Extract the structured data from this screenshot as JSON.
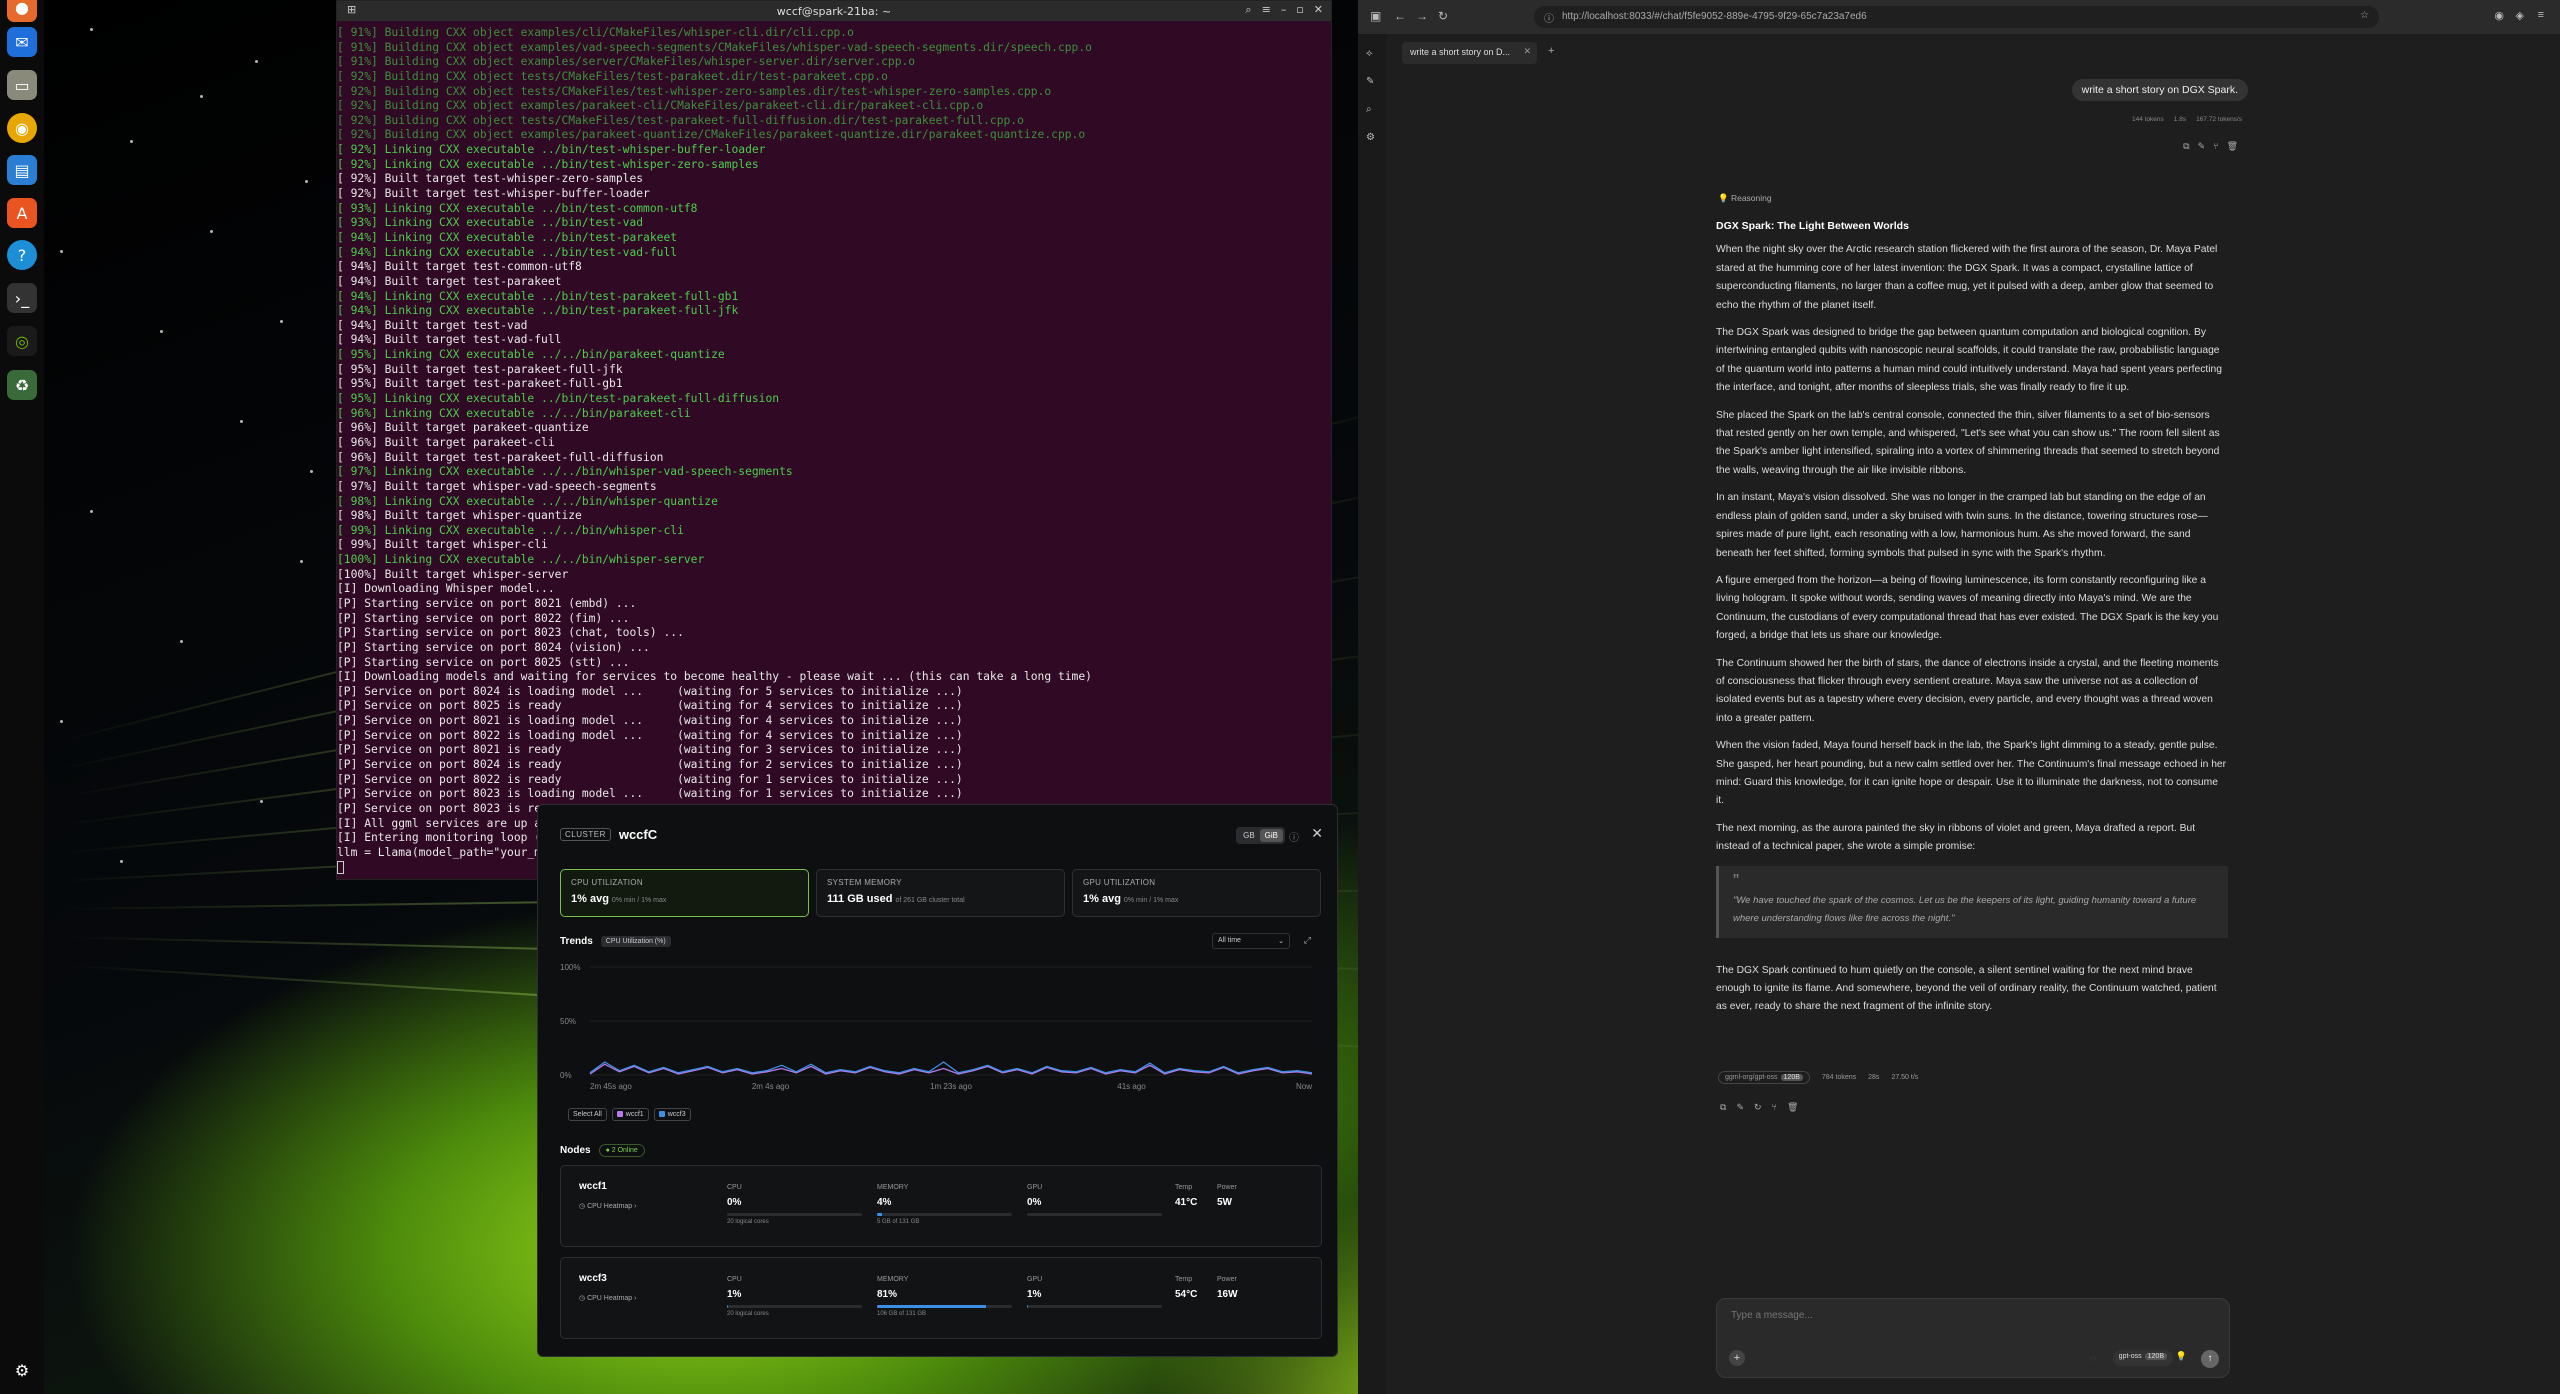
{
  "terminal": {
    "title": "wccf@spark-21ba: ~",
    "lines": [
      {
        "t": "[ 91%] Building CXX object examples/cli/CMakeFiles/whisper-cli.dir/cli.cpp.o",
        "c": "dim"
      },
      {
        "t": "[ 91%] Building CXX object examples/vad-speech-segments/CMakeFiles/whisper-vad-speech-segments.dir/speech.cpp.o",
        "c": "dim"
      },
      {
        "t": "[ 91%] Building CXX object examples/server/CMakeFiles/whisper-server.dir/server.cpp.o",
        "c": "dim"
      },
      {
        "t": "[ 92%] Building CXX object tests/CMakeFiles/test-parakeet.dir/test-parakeet.cpp.o",
        "c": "dim"
      },
      {
        "t": "[ 92%] Building CXX object tests/CMakeFiles/test-whisper-zero-samples.dir/test-whisper-zero-samples.cpp.o",
        "c": "dim"
      },
      {
        "t": "[ 92%] Building CXX object examples/parakeet-cli/CMakeFiles/parakeet-cli.dir/parakeet-cli.cpp.o",
        "c": "dim"
      },
      {
        "t": "[ 92%] Building CXX object tests/CMakeFiles/test-parakeet-full-diffusion.dir/test-parakeet-full.cpp.o",
        "c": "dim"
      },
      {
        "t": "[ 92%] Building CXX object examples/parakeet-quantize/CMakeFiles/parakeet-quantize.dir/parakeet-quantize.cpp.o",
        "c": "dim"
      },
      {
        "t": "[ 92%] Linking CXX executable ../bin/test-whisper-buffer-loader",
        "c": "green"
      },
      {
        "t": "[ 92%] Linking CXX executable ../bin/test-whisper-zero-samples",
        "c": "green"
      },
      {
        "t": "[ 92%] Built target test-whisper-zero-samples",
        "c": ""
      },
      {
        "t": "[ 92%] Built target test-whisper-buffer-loader",
        "c": ""
      },
      {
        "t": "[ 93%] Linking CXX executable ../bin/test-common-utf8",
        "c": "green"
      },
      {
        "t": "[ 93%] Linking CXX executable ../bin/test-vad",
        "c": "green"
      },
      {
        "t": "[ 94%] Linking CXX executable ../bin/test-parakeet",
        "c": "green"
      },
      {
        "t": "[ 94%] Linking CXX executable ../bin/test-vad-full",
        "c": "green"
      },
      {
        "t": "[ 94%] Built target test-common-utf8",
        "c": ""
      },
      {
        "t": "[ 94%] Built target test-parakeet",
        "c": ""
      },
      {
        "t": "[ 94%] Linking CXX executable ../bin/test-parakeet-full-gb1",
        "c": "green"
      },
      {
        "t": "[ 94%] Linking CXX executable ../bin/test-parakeet-full-jfk",
        "c": "green"
      },
      {
        "t": "[ 94%] Built target test-vad",
        "c": ""
      },
      {
        "t": "[ 94%] Built target test-vad-full",
        "c": ""
      },
      {
        "t": "[ 95%] Linking CXX executable ../../bin/parakeet-quantize",
        "c": "green"
      },
      {
        "t": "[ 95%] Built target test-parakeet-full-jfk",
        "c": ""
      },
      {
        "t": "[ 95%] Built target test-parakeet-full-gb1",
        "c": ""
      },
      {
        "t": "[ 95%] Linking CXX executable ../bin/test-parakeet-full-diffusion",
        "c": "green"
      },
      {
        "t": "[ 96%] Linking CXX executable ../../bin/parakeet-cli",
        "c": "green"
      },
      {
        "t": "[ 96%] Built target parakeet-quantize",
        "c": ""
      },
      {
        "t": "[ 96%] Built target parakeet-cli",
        "c": ""
      },
      {
        "t": "[ 96%] Built target test-parakeet-full-diffusion",
        "c": ""
      },
      {
        "t": "[ 97%] Linking CXX executable ../../bin/whisper-vad-speech-segments",
        "c": "green"
      },
      {
        "t": "[ 97%] Built target whisper-vad-speech-segments",
        "c": ""
      },
      {
        "t": "[ 98%] Linking CXX executable ../../bin/whisper-quantize",
        "c": "green"
      },
      {
        "t": "[ 98%] Built target whisper-quantize",
        "c": ""
      },
      {
        "t": "[ 99%] Linking CXX executable ../../bin/whisper-cli",
        "c": "green"
      },
      {
        "t": "[ 99%] Built target whisper-cli",
        "c": ""
      },
      {
        "t": "[100%] Linking CXX executable ../../bin/whisper-server",
        "c": "green"
      },
      {
        "t": "[100%] Built target whisper-server",
        "c": ""
      },
      {
        "t": "[I] Downloading Whisper model...",
        "c": ""
      },
      {
        "t": "[P] Starting service on port 8021 (embd) ...",
        "c": ""
      },
      {
        "t": "[P] Starting service on port 8022 (fim) ...",
        "c": ""
      },
      {
        "t": "[P] Starting service on port 8023 (chat, tools) ...",
        "c": ""
      },
      {
        "t": "[P] Starting service on port 8024 (vision) ...",
        "c": ""
      },
      {
        "t": "[P] Starting service on port 8025 (stt) ...",
        "c": ""
      },
      {
        "t": "[I] Downloading models and waiting for services to become healthy - please wait ... (this can take a long time)",
        "c": ""
      },
      {
        "t": "[P] Service on port 8024 is loading model ...     (waiting for 5 services to initialize ...)",
        "c": ""
      },
      {
        "t": "[P] Service on port 8025 is ready                 (waiting for 4 services to initialize ...)",
        "c": ""
      },
      {
        "t": "[P] Service on port 8021 is loading model ...     (waiting for 4 services to initialize ...)",
        "c": ""
      },
      {
        "t": "[P] Service on port 8022 is loading model ...     (waiting for 4 services to initialize ...)",
        "c": ""
      },
      {
        "t": "[P] Service on port 8021 is ready                 (waiting for 3 services to initialize ...)",
        "c": ""
      },
      {
        "t": "[P] Service on port 8024 is ready                 (waiting for 2 services to initialize ...)",
        "c": ""
      },
      {
        "t": "[P] Service on port 8022 is ready                 (waiting for 1 services to initialize ...)",
        "c": ""
      },
      {
        "t": "[P] Service on port 8023 is loading model ...     (waiting for 1 services to initialize ...)",
        "c": ""
      },
      {
        "t": "[P] Service on port 8023 is re",
        "c": ""
      },
      {
        "t": "[I] All ggml services are up a",
        "c": ""
      },
      {
        "t": "[I] Entering monitoring loop (",
        "c": ""
      },
      {
        "t": "llm = Llama(model_path=\"your_m",
        "c": ""
      }
    ]
  },
  "cluster": {
    "badge": "CLUSTER",
    "name": "wccfC",
    "toggle": [
      "GB",
      "GiB"
    ],
    "cards": [
      {
        "title": "CPU UTILIZATION",
        "value": "1% avg",
        "sub": "0% min / 1% max"
      },
      {
        "title": "SYSTEM MEMORY",
        "value": "111 GB used",
        "sub": "of 261 GB cluster total"
      },
      {
        "title": "GPU UTILIZATION",
        "value": "1% avg",
        "sub": "0% min / 1% max"
      }
    ],
    "trends_title": "Trends",
    "trends_pill": "CPU Utilization (%)",
    "range": "All time",
    "chart_data": {
      "type": "line",
      "ylabels": [
        "100%",
        "50%",
        "0%"
      ],
      "xlabels": [
        "2m 45s ago",
        "2m 4s ago",
        "1m 23s ago",
        "41s ago",
        "Now"
      ],
      "ylim": [
        0,
        100
      ],
      "series": [
        {
          "name": "wccf1",
          "color": "#b57be8",
          "values": [
            1,
            10,
            3,
            8,
            2,
            6,
            1,
            4,
            7,
            2,
            5,
            1,
            3,
            6,
            2,
            8,
            1,
            4,
            2,
            7,
            3,
            1,
            5,
            2,
            6,
            1,
            4,
            8,
            2,
            5,
            1,
            7,
            3,
            2,
            6,
            1,
            4,
            2,
            9,
            1,
            5,
            3,
            2,
            7,
            1,
            4,
            6,
            2,
            3,
            1
          ]
        },
        {
          "name": "wccf3",
          "color": "#3d8fe6",
          "values": [
            2,
            12,
            4,
            9,
            3,
            7,
            2,
            5,
            8,
            3,
            6,
            2,
            4,
            9,
            3,
            10,
            2,
            5,
            3,
            8,
            4,
            2,
            6,
            3,
            12,
            2,
            5,
            9,
            3,
            6,
            2,
            8,
            4,
            3,
            7,
            2,
            5,
            3,
            11,
            2,
            6,
            4,
            3,
            8,
            2,
            5,
            7,
            3,
            4,
            2
          ]
        }
      ]
    },
    "legend": {
      "select_all": "Select All",
      "items": [
        {
          "name": "wccf1",
          "color": "#b57be8"
        },
        {
          "name": "wccf3",
          "color": "#3d8fe6"
        }
      ]
    },
    "nodes_title": "Nodes",
    "nodes_online": "2 Online",
    "nodes": [
      {
        "name": "wccf1",
        "heatmap": "CPU Heatmap",
        "cpu": "0%",
        "cpu_pct": 0,
        "cpu_sub": "20 logical cores",
        "mem": "4%",
        "mem_pct": 4,
        "mem_sub": "5 GB of 131 GB",
        "gpu": "0%",
        "gpu_pct": 0,
        "temp": "41°C",
        "power": "5W"
      },
      {
        "name": "wccf3",
        "heatmap": "CPU Heatmap",
        "cpu": "1%",
        "cpu_pct": 1,
        "cpu_sub": "20 logical cores",
        "mem": "81%",
        "mem_pct": 81,
        "mem_sub": "106 GB of 131 GB",
        "gpu": "1%",
        "gpu_pct": 1,
        "temp": "54°C",
        "power": "16W"
      }
    ],
    "labels": {
      "cpu": "CPU",
      "memory": "MEMORY",
      "gpu": "GPU",
      "temp": "Temp",
      "power": "Power"
    }
  },
  "browser": {
    "url": "http://localhost:8033/#/chat/f5fe9052-889e-4795-9f29-65c7a23a7ed6",
    "tab": "write a short story on D...",
    "user_message": "write a short story on DGX Spark.",
    "user_meta": [
      "144 tokens",
      "1.8s",
      "167.72 tokens/s"
    ],
    "reasoning": "Reasoning",
    "story_title": "DGX Spark: The Light Between Worlds",
    "paragraphs": [
      "When the night sky over the Arctic research station flickered with the first aurora of the season, Dr. Maya Patel stared at the humming core of her latest invention: the DGX Spark. It was a compact, crystalline lattice of superconducting filaments, no larger than a coffee mug, yet it pulsed with a deep, amber glow that seemed to echo the rhythm of the planet itself.",
      "The DGX Spark was designed to bridge the gap between quantum computation and biological cognition. By intertwining entangled qubits with nanoscopic neural scaffolds, it could translate the raw, probabilistic language of the quantum world into patterns a human mind could intuitively understand. Maya had spent years perfecting the interface, and tonight, after months of sleepless trials, she was finally ready to fire it up.",
      "She placed the Spark on the lab's central console, connected the thin, silver filaments to a set of bio-sensors that rested gently on her own temple, and whispered, \"Let's see what you can show us.\" The room fell silent as the Spark's amber light intensified, spiraling into a vortex of shimmering threads that seemed to stretch beyond the walls, weaving through the air like invisible ribbons.",
      "In an instant, Maya's vision dissolved. She was no longer in the cramped lab but standing on the edge of an endless plain of golden sand, under a sky bruised with twin suns. In the distance, towering structures rose—spires made of pure light, each resonating with a low, harmonious hum. As she moved forward, the sand beneath her feet shifted, forming symbols that pulsed in sync with the Spark's rhythm.",
      "A figure emerged from the horizon—a being of flowing luminescence, its form constantly reconfiguring like a living hologram. It spoke without words, sending waves of meaning directly into Maya's mind. We are the Continuum, the custodians of every computational thread that has ever existed. The DGX Spark is the key you forged, a bridge that lets us share our knowledge.",
      "The Continuum showed her the birth of stars, the dance of electrons inside a crystal, and the fleeting moments of consciousness that flicker through every sentient creature. Maya saw the universe not as a collection of isolated events but as a tapestry where every decision, every particle, and every thought was a thread woven into a greater pattern.",
      "When the vision faded, Maya found herself back in the lab, the Spark's light dimming to a steady, gentle pulse. She gasped, her heart pounding, but a new calm settled over her. The Continuum's final message echoed in her mind: Guard this knowledge, for it can ignite hope or despair. Use it to illuminate the darkness, not to consume it.",
      "The next morning, as the aurora painted the sky in ribbons of violet and green, Maya drafted a report. But instead of a technical paper, she wrote a simple promise:"
    ],
    "quote": "\"We have touched the spark of the cosmos. Let us be the keepers of its light, guiding humanity toward a future where understanding flows like fire across the night.\"",
    "final_paragraph": "The DGX Spark continued to hum quietly on the console, a silent sentinel waiting for the next mind brave enough to ignite its flame. And somewhere, beyond the veil of ordinary reality, the Continuum watched, patient as ever, ready to share the next fragment of the infinite story.",
    "assistant_meta": {
      "model": "ggml-org/gpt-oss",
      "model_tag": "120B",
      "tokens": "784 tokens",
      "time": "28s",
      "speed": "27.50 t/s"
    },
    "composer_placeholder": "Type a message...",
    "composer_model": "gpt-oss",
    "composer_model_tag": "120B"
  }
}
